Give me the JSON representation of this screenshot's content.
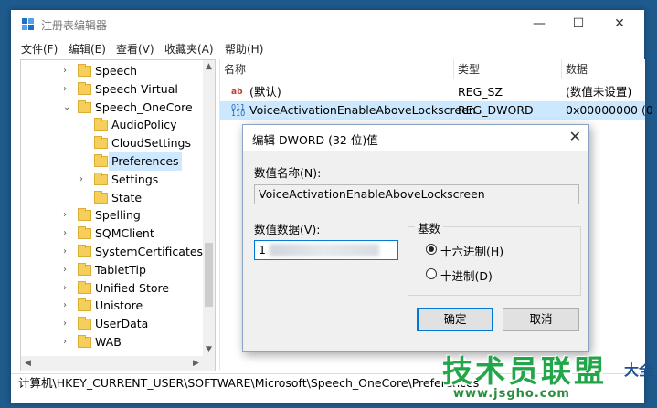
{
  "window": {
    "title": "注册表编辑器",
    "minimize": "—",
    "maximize": "☐",
    "close": "✕"
  },
  "menu": [
    "文件(F)",
    "编辑(E)",
    "查看(V)",
    "收藏夹(A)",
    "帮助(H)"
  ],
  "tree": {
    "items": [
      {
        "label": "Speech",
        "expander": "›",
        "level": 1
      },
      {
        "label": "Speech Virtual",
        "expander": "›",
        "level": 1
      },
      {
        "label": "Speech_OneCore",
        "expander": "⌄",
        "level": 1
      },
      {
        "label": "AudioPolicy",
        "expander": "",
        "level": 2
      },
      {
        "label": "CloudSettings",
        "expander": "",
        "level": 2
      },
      {
        "label": "Preferences",
        "expander": "",
        "level": 2,
        "selected": true
      },
      {
        "label": "Settings",
        "expander": "›",
        "level": 2
      },
      {
        "label": "State",
        "expander": "",
        "level": 2
      },
      {
        "label": "Spelling",
        "expander": "›",
        "level": 1
      },
      {
        "label": "SQMClient",
        "expander": "›",
        "level": 1
      },
      {
        "label": "SystemCertificates",
        "expander": "›",
        "level": 1
      },
      {
        "label": "TabletTip",
        "expander": "›",
        "level": 1
      },
      {
        "label": "Unified Store",
        "expander": "›",
        "level": 1
      },
      {
        "label": "Unistore",
        "expander": "›",
        "level": 1
      },
      {
        "label": "UserData",
        "expander": "›",
        "level": 1
      },
      {
        "label": "WAB",
        "expander": "›",
        "level": 1
      }
    ]
  },
  "list": {
    "columns": [
      "名称",
      "类型",
      "数据"
    ],
    "rows": [
      {
        "icon": "string-value-icon",
        "name": "(默认)",
        "type": "REG_SZ",
        "data": "(数值未设置)"
      },
      {
        "icon": "binary-value-icon",
        "name": "VoiceActivationEnableAboveLockscreen",
        "type": "REG_DWORD",
        "data": "0x00000000 (0"
      }
    ]
  },
  "status_bar": "计算机\\HKEY_CURRENT_USER\\SOFTWARE\\Microsoft\\Speech_OneCore\\Preferences",
  "dialog": {
    "title": "编辑 DWORD (32 位)值",
    "name_label": "数值名称(N):",
    "name_value": "VoiceActivationEnableAboveLockscreen",
    "data_label": "数值数据(V):",
    "data_value": "1",
    "base_label": "基数",
    "base_options": [
      {
        "label": "十六进制(H)",
        "checked": true
      },
      {
        "label": "十进制(D)",
        "checked": false
      }
    ],
    "ok": "确定",
    "cancel": "取消"
  },
  "watermark": {
    "brand": "技术员联盟",
    "suffix": "大全",
    "url": "www.jsgho.com"
  }
}
